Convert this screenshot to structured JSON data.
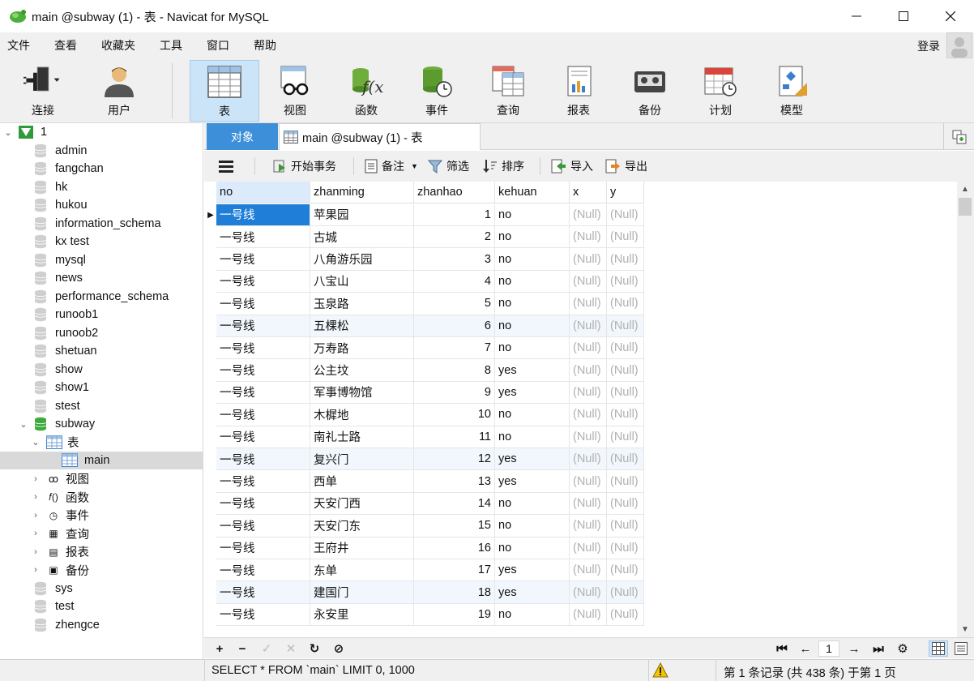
{
  "window": {
    "title": "main @subway (1) - 表 - Navicat for MySQL",
    "login": "登录"
  },
  "menu": [
    "文件",
    "查看",
    "收藏夹",
    "工具",
    "窗口",
    "帮助"
  ],
  "ribbon": {
    "connect": "连接",
    "user": "用户",
    "table": "表",
    "view": "视图",
    "function": "函数",
    "event": "事件",
    "query": "查询",
    "report": "报表",
    "backup": "备份",
    "schedule": "计划",
    "model": "模型"
  },
  "tree": {
    "connection": "1",
    "databases": [
      "admin",
      "fangchan",
      "hk",
      "hukou",
      "information_schema",
      "kx test",
      "mysql",
      "news",
      "performance_schema",
      "runoob1",
      "runoob2",
      "shetuan",
      "show",
      "show1",
      "stest"
    ],
    "open_db": "subway",
    "tables_node": "表",
    "selected_table": "main",
    "subnodes": [
      "视图",
      "函数",
      "事件",
      "查询",
      "报表",
      "备份"
    ],
    "after": [
      "sys",
      "test",
      "zhengce"
    ]
  },
  "tabs": {
    "objects": "对象",
    "main_tab": "main @subway (1) - 表"
  },
  "toolbar": {
    "begin_tx": "开始事务",
    "memo": "备注",
    "filter": "筛选",
    "sort": "排序",
    "import": "导入",
    "export": "导出"
  },
  "grid": {
    "columns": [
      "no",
      "zhanming",
      "zhanhao",
      "kehuan",
      "x",
      "y"
    ],
    "null_text": "(Null)",
    "rows": [
      [
        "一号线",
        "苹果园",
        "1",
        "no"
      ],
      [
        "一号线",
        "古城",
        "2",
        "no"
      ],
      [
        "一号线",
        "八角游乐园",
        "3",
        "no"
      ],
      [
        "一号线",
        "八宝山",
        "4",
        "no"
      ],
      [
        "一号线",
        "玉泉路",
        "5",
        "no"
      ],
      [
        "一号线",
        "五棵松",
        "6",
        "no"
      ],
      [
        "一号线",
        "万寿路",
        "7",
        "no"
      ],
      [
        "一号线",
        "公主坟",
        "8",
        "yes"
      ],
      [
        "一号线",
        "军事博物馆",
        "9",
        "yes"
      ],
      [
        "一号线",
        "木樨地",
        "10",
        "no"
      ],
      [
        "一号线",
        "南礼士路",
        "11",
        "no"
      ],
      [
        "一号线",
        "复兴门",
        "12",
        "yes"
      ],
      [
        "一号线",
        "西单",
        "13",
        "yes"
      ],
      [
        "一号线",
        "天安门西",
        "14",
        "no"
      ],
      [
        "一号线",
        "天安门东",
        "15",
        "no"
      ],
      [
        "一号线",
        "王府井",
        "16",
        "no"
      ],
      [
        "一号线",
        "东单",
        "17",
        "yes"
      ],
      [
        "一号线",
        "建国门",
        "18",
        "yes"
      ],
      [
        "一号线",
        "永安里",
        "19",
        "no"
      ]
    ]
  },
  "pager": {
    "page": "1"
  },
  "status": {
    "sql": "SELECT * FROM `main` LIMIT 0, 1000",
    "records": "第 1 条记录 (共 438 条) 于第 1 页"
  },
  "colors": {
    "accent": "#3c8fd8",
    "selection": "#1f7ed8",
    "ribbon_active": "#cce4f7"
  }
}
